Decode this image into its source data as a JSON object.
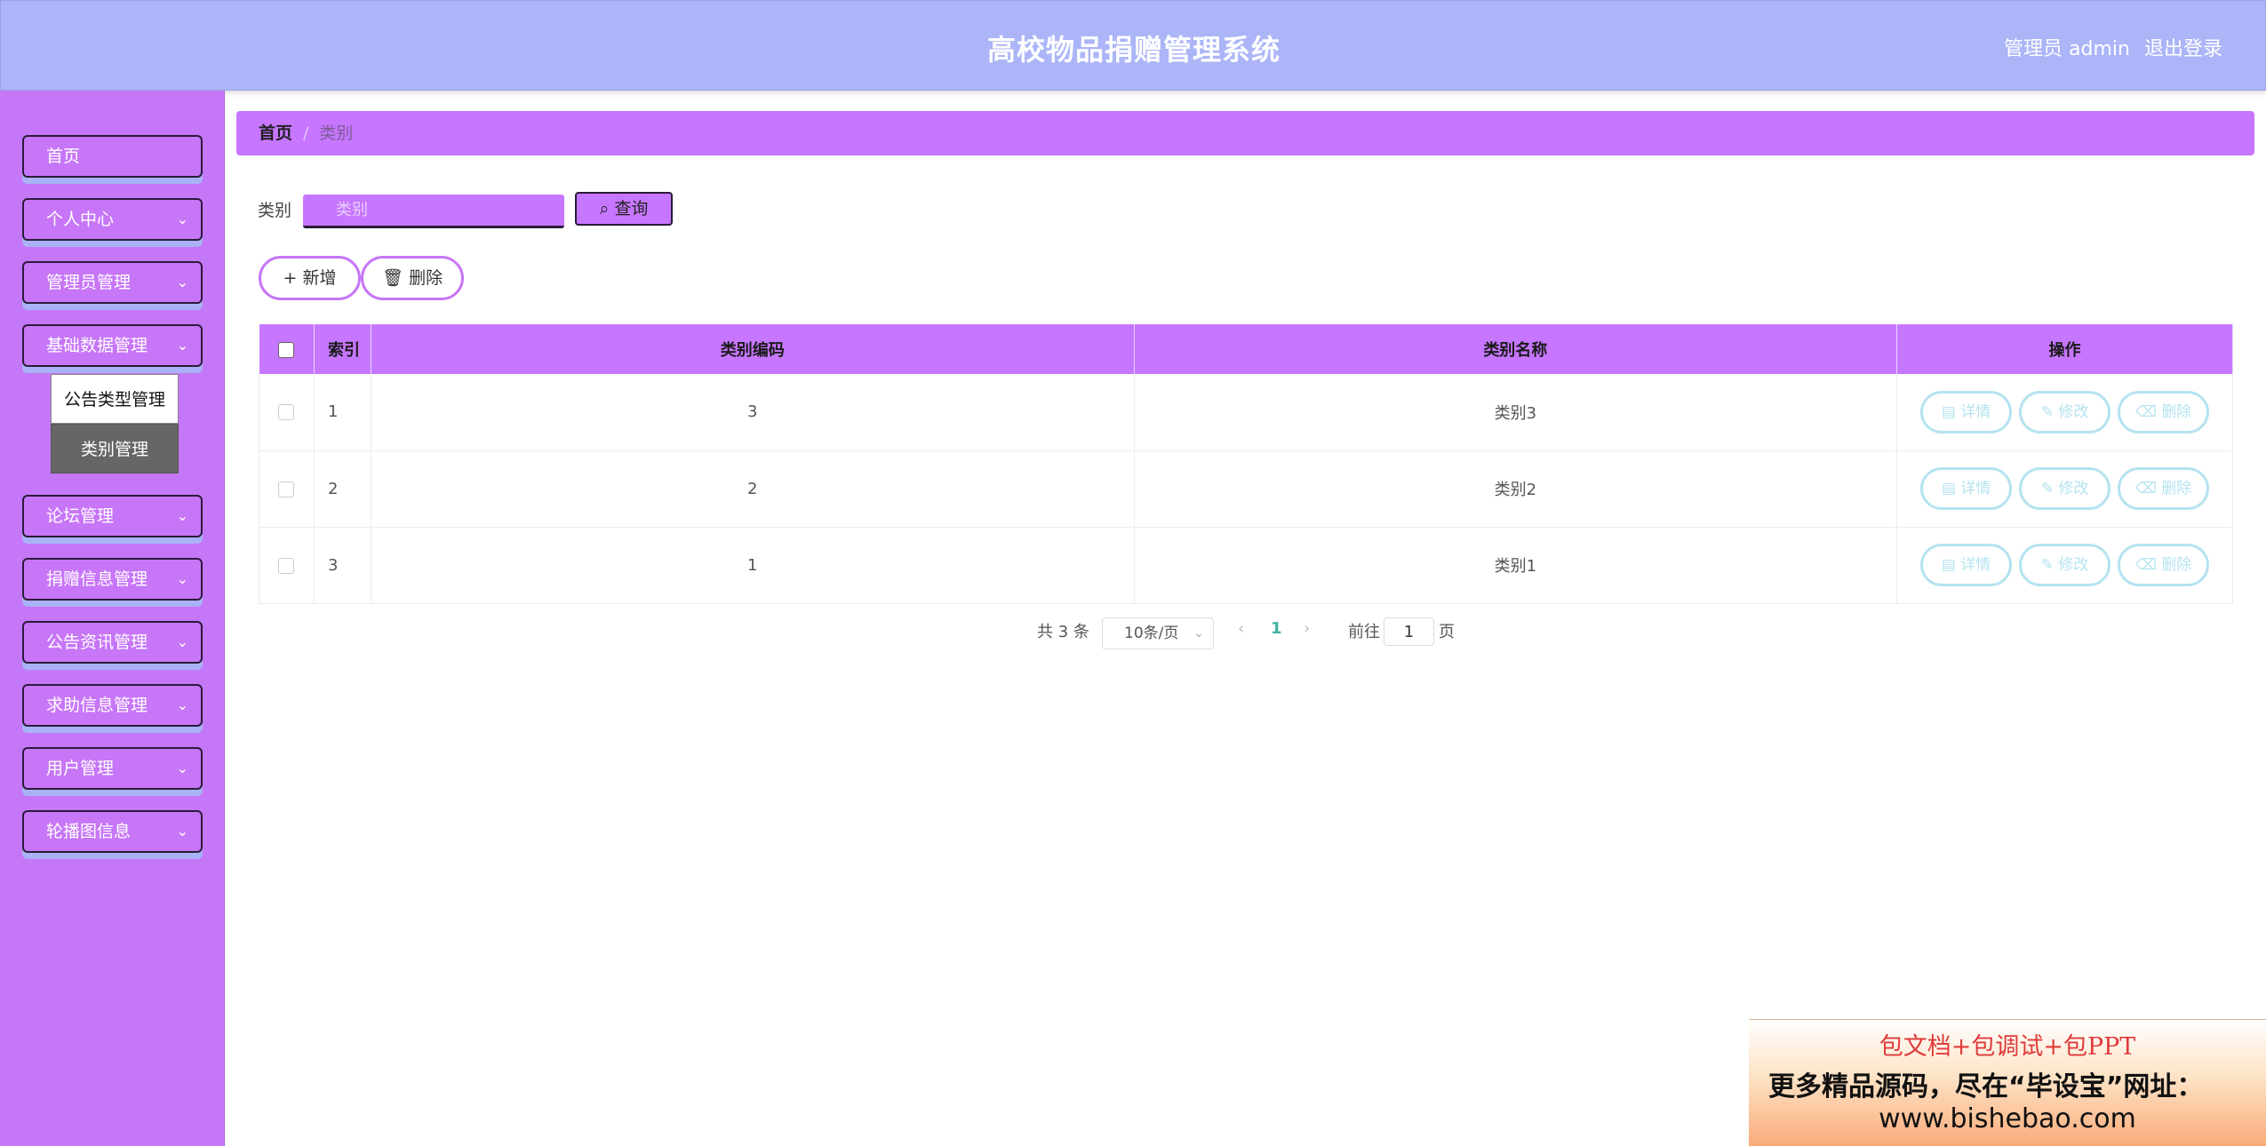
{
  "header": {
    "title": "高校物品捐赠管理系统",
    "user": "管理员 admin",
    "logout": "退出登录"
  },
  "sidebar": {
    "items": [
      {
        "label": "首页"
      },
      {
        "label": "个人中心"
      },
      {
        "label": "管理员管理"
      },
      {
        "label": "基础数据管理"
      },
      {
        "label": "论坛管理"
      },
      {
        "label": "捐赠信息管理"
      },
      {
        "label": "公告资讯管理"
      },
      {
        "label": "求助信息管理"
      },
      {
        "label": "用户管理"
      },
      {
        "label": "轮播图信息"
      }
    ],
    "submenu": [
      {
        "label": "公告类型管理"
      },
      {
        "label": "类别管理"
      }
    ]
  },
  "breadcrumb": {
    "home": "首页",
    "separator": "/",
    "current": "类别"
  },
  "search": {
    "label": "类别",
    "placeholder": "类别",
    "query_button": "查询"
  },
  "actions": {
    "add": "新增",
    "delete": "删除"
  },
  "table": {
    "headers": {
      "index": "索引",
      "code": "类别编码",
      "name": "类别名称",
      "ops": "操作"
    },
    "rows": [
      {
        "index": "1",
        "code": "3",
        "name": "类别3"
      },
      {
        "index": "2",
        "code": "2",
        "name": "类别2"
      },
      {
        "index": "3",
        "code": "1",
        "name": "类别1"
      }
    ],
    "op_labels": {
      "detail": "详情",
      "edit": "修改",
      "delete": "删除"
    }
  },
  "pagination": {
    "total": "共 3 条",
    "page_size": "10条/页",
    "current_page": "1",
    "goto_prefix": "前往",
    "goto_value": "1",
    "goto_suffix": "页"
  },
  "watermark": {
    "line1": "包文档+包调试+包PPT",
    "line2": "更多精品源码，尽在“毕设宝”网址：",
    "line3": "www.bishebao.com"
  },
  "colors": {
    "header": "#abb5f7",
    "sidebar": "#c477f7",
    "accent": "#c776ff",
    "op_button": "#b5e3f0"
  }
}
